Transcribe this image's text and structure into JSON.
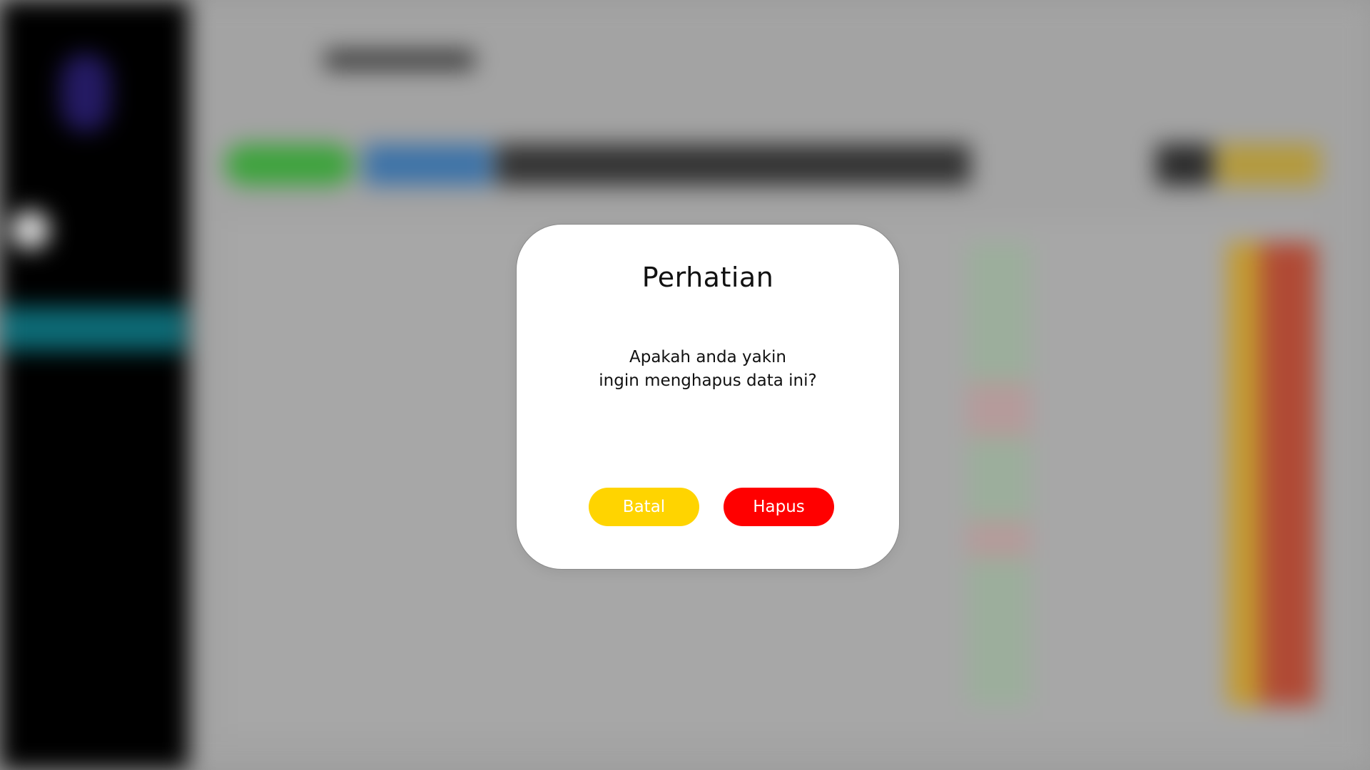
{
  "dialog": {
    "title": "Perhatian",
    "message_line1": "Apakah anda yakin",
    "message_line2": "ingin menghapus data ini?",
    "cancel_label": "Batal",
    "delete_label": "Hapus"
  },
  "colors": {
    "cancel_button": "#ffd400",
    "delete_button": "#ff0000",
    "dialog_background": "#ffffff",
    "sidebar_background": "#000000",
    "sidebar_active_item": "#0d6a75",
    "toolbar_green": "#3ea33d",
    "toolbar_blue": "#3e73a7",
    "toolbar_yellow": "#b49a3d"
  },
  "background_state": "blurred"
}
